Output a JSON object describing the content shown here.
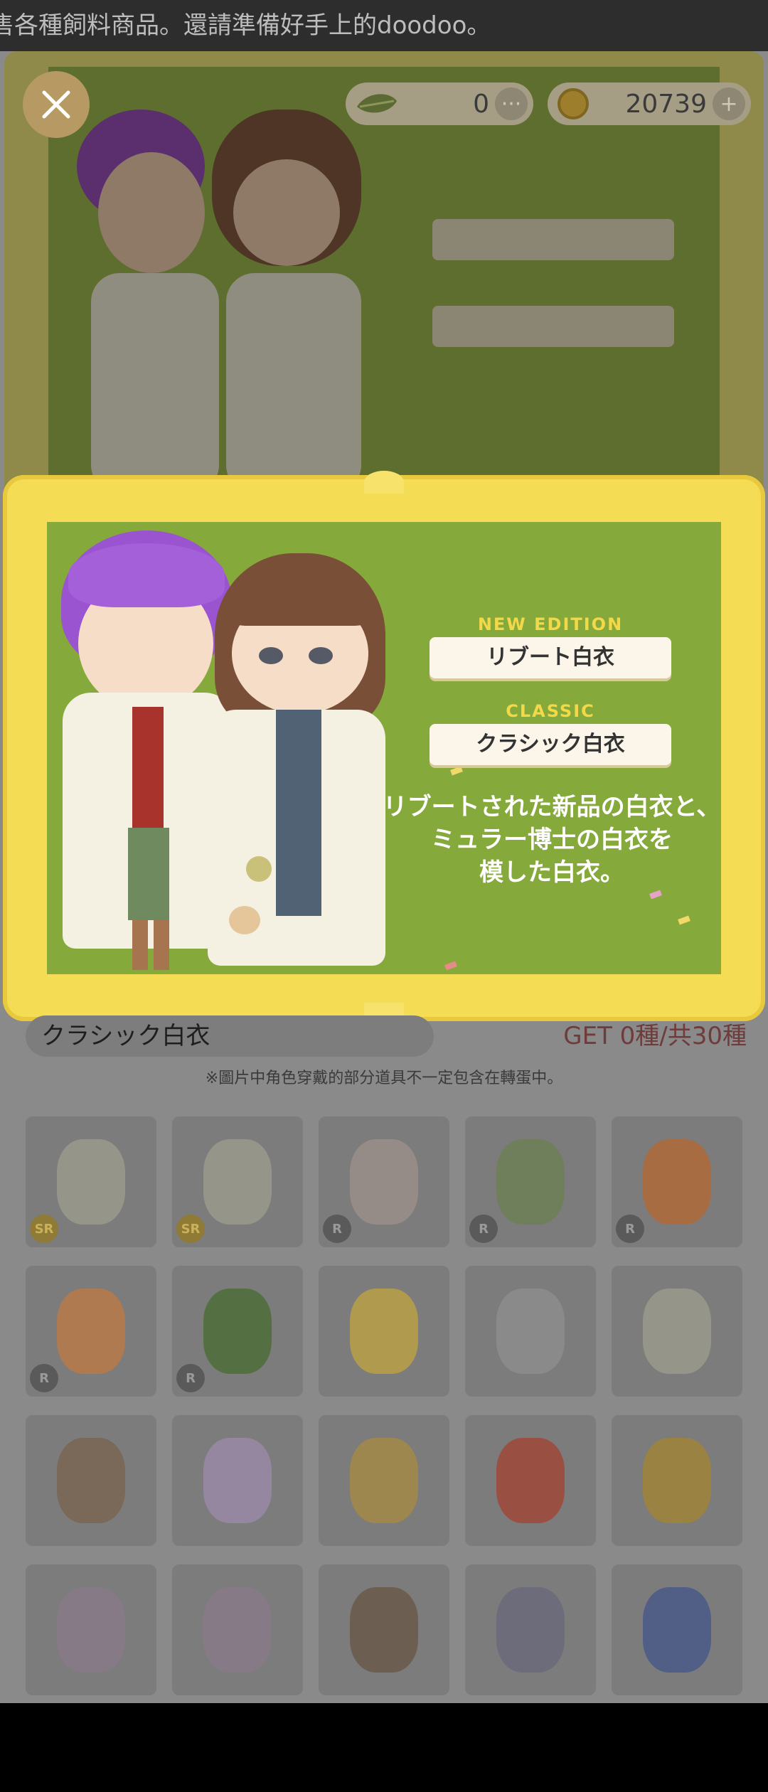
{
  "marquee": {
    "text": "售各種飼料商品。還請準備好手上的doodoo。"
  },
  "currency": {
    "leaf": {
      "value": "0",
      "more": "···"
    },
    "coin": {
      "value": "20739",
      "add": "+"
    }
  },
  "banner": {
    "new_label": "NEW EDITION",
    "new_name": "リブート白衣",
    "classic_label": "CLASSIC",
    "classic_name": "クラシック白衣",
    "desc_line1": "リブートされた新品の白衣と、",
    "desc_line2": "ミュラー博士の白衣を",
    "desc_line3": "模した白衣。"
  },
  "collection": {
    "set_name": "クラシック白衣",
    "get_count": "GET 0種/共30種",
    "note": "※圖片中角色穿戴的部分道具不一定包含在轉蛋中。"
  },
  "grid": [
    {
      "name": "white-coat-stained-item",
      "rarity": "SR"
    },
    {
      "name": "white-coat-item",
      "rarity": "SR"
    },
    {
      "name": "patched-doll-item",
      "rarity": "R"
    },
    {
      "name": "bonsai-hat-item",
      "rarity": "R"
    },
    {
      "name": "orange-creature-item",
      "rarity": "R"
    },
    {
      "name": "orange-creature-balloon-item",
      "rarity": "R"
    },
    {
      "name": "green-bear-balloon-item",
      "rarity": "R"
    },
    {
      "name": "party-glasses-item",
      "rarity": ""
    },
    {
      "name": "round-glasses-item",
      "rarity": ""
    },
    {
      "name": "photo-frame-item",
      "rarity": ""
    },
    {
      "name": "face-head-item",
      "rarity": ""
    },
    {
      "name": "star-tag-item",
      "rarity": ""
    },
    {
      "name": "potion-flask-item",
      "rarity": ""
    },
    {
      "name": "red-monster-item",
      "rarity": ""
    },
    {
      "name": "spider-item",
      "rarity": ""
    },
    {
      "name": "cake-stand-item",
      "rarity": ""
    },
    {
      "name": "cake-stand-item-2",
      "rarity": ""
    },
    {
      "name": "chopsticks-item",
      "rarity": ""
    },
    {
      "name": "flag-item",
      "rarity": ""
    },
    {
      "name": "sailor-costume-item",
      "rarity": ""
    }
  ]
}
